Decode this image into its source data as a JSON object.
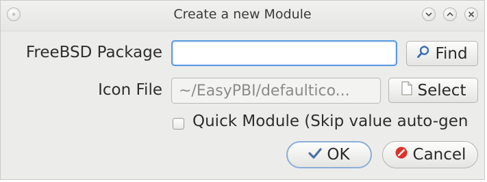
{
  "window": {
    "title": "Create a new Module"
  },
  "form": {
    "package_label": "FreeBSD Package",
    "package_value": "",
    "find_label": "Find",
    "icon_label": "Icon File",
    "icon_placeholder": "~/EasyPBI/defaultico...",
    "select_label": "Select",
    "quick_label": "Quick Module (Skip value auto-gen",
    "quick_checked": false
  },
  "actions": {
    "ok_label": "OK",
    "cancel_label": "Cancel"
  },
  "icons": {
    "titlebar_left": "app-menu-icon",
    "minimize": "chevron-down-icon",
    "maximize": "chevron-up-icon",
    "close": "close-icon",
    "find": "search-icon",
    "select": "document-icon",
    "ok": "checkmark-icon",
    "cancel": "cancel-icon"
  },
  "colors": {
    "focus_border": "#5b9be0",
    "cancel_icon": "#d9342b",
    "ok_icon": "#4a6fa5",
    "search_icon": "#3d6fb0"
  }
}
